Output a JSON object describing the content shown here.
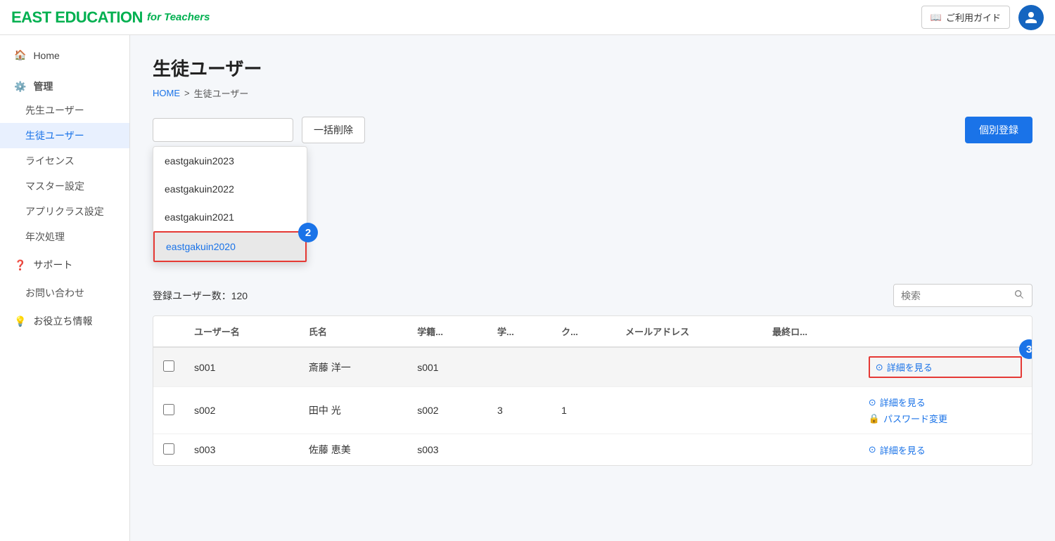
{
  "header": {
    "logo_east": "EAST EDUCATION",
    "logo_teachers": "for Teachers",
    "guide_btn": "ご利用ガイド",
    "guide_icon": "📖"
  },
  "sidebar": {
    "home": "Home",
    "kanri": "管理",
    "sensei": "先生ユーザー",
    "seito": "生徒ユーザー",
    "license": "ライセンス",
    "master": "マスター設定",
    "appclass": "アプリクラス設定",
    "nenjishori": "年次処理",
    "support": "サポート",
    "contact": "お問い合わせ",
    "useful": "お役立ち情報"
  },
  "page": {
    "title": "生徒ユーザー",
    "breadcrumb_home": "HOME",
    "breadcrumb_sep": ">",
    "breadcrumb_current": "生徒ユーザー"
  },
  "toolbar": {
    "selected_year": "eastgakuin2020",
    "bulk_delete": "一括削除",
    "register": "個別登録",
    "dropdown_items": [
      "eastgakuin2023",
      "eastgakuin2022",
      "eastgakuin2021",
      "eastgakuin2020"
    ]
  },
  "stats": {
    "user_count_label": "登録ユーザー数：120",
    "search_placeholder": "検索"
  },
  "table": {
    "headers": [
      "",
      "ユーザー名",
      "氏名",
      "学籍...",
      "学...",
      "ク...",
      "メールアドレス",
      "最終ロ...",
      ""
    ],
    "rows": [
      {
        "id": "s001",
        "name": "斎藤 洋一",
        "gakuseki": "s001",
        "gaku": "",
        "ku": "",
        "email": "",
        "last": "",
        "actions": [
          "詳細を見る"
        ]
      },
      {
        "id": "s002",
        "name": "田中 光",
        "gakuseki": "s002",
        "gaku": "3",
        "ku": "1",
        "email": "",
        "last": "",
        "actions": [
          "詳細を見る",
          "パスワード変更"
        ]
      },
      {
        "id": "s003",
        "name": "佐藤 恵美",
        "gakuseki": "s003",
        "gaku": "",
        "ku": "",
        "email": "",
        "last": "",
        "actions": [
          "詳細を見る"
        ]
      }
    ]
  },
  "steps": {
    "step2": "2",
    "step3": "3"
  }
}
